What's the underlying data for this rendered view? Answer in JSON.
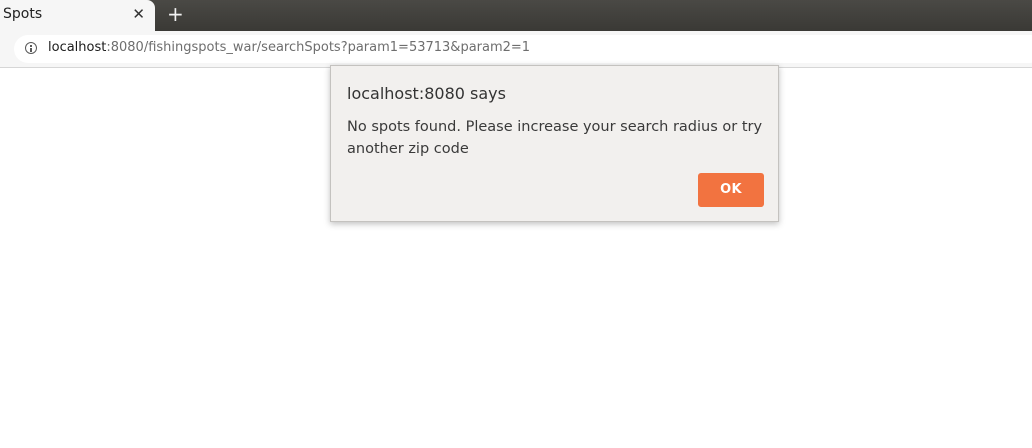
{
  "browser": {
    "tab": {
      "title": "Spots",
      "close_glyph": "✕"
    },
    "new_tab_glyph": "+",
    "address_bar": {
      "icon": "info-icon",
      "url_host": "localhost",
      "url_rest": ":8080/fishingspots_war/searchSpots?param1=53713&param2=1"
    }
  },
  "dialog": {
    "title": "localhost:8080 says",
    "message": "No spots found. Please increase your search radius or try another zip code",
    "ok_label": "OK",
    "ok_color": "#f27340"
  }
}
